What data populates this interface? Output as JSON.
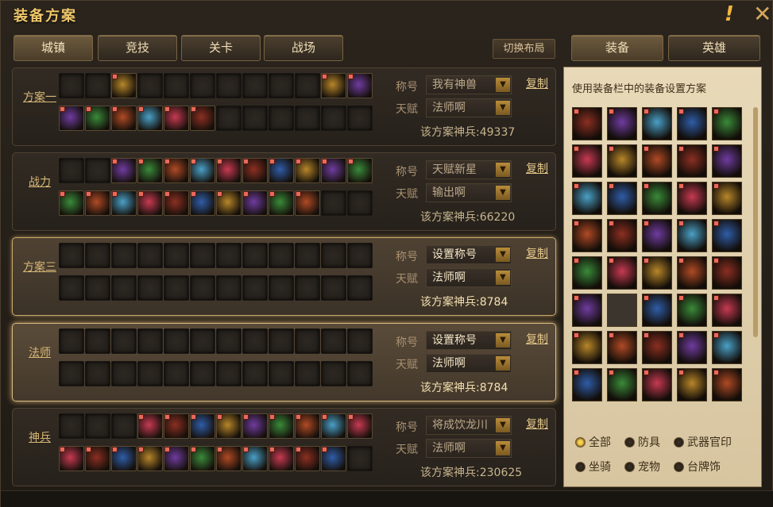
{
  "title": "装备方案",
  "tabs": [
    "城镇",
    "竞技",
    "关卡",
    "战场"
  ],
  "switch_layout": "切换布局",
  "right_tabs": [
    "装备",
    "英雄"
  ],
  "hint": "使用装备栏中的装备设置方案",
  "filters": [
    "全部",
    "防具",
    "武器官印",
    "坐骑",
    "宠物",
    "台牌饰"
  ],
  "labels": {
    "title": "称号",
    "talent": "天赋",
    "copy": "复制"
  },
  "plans": [
    {
      "name": "方案一",
      "title_value": "我有神兽",
      "talent_value": "法师啊",
      "power": "该方案神兵:49337"
    },
    {
      "name": "战力",
      "title_value": "天赋新星",
      "talent_value": "输出啊",
      "power": "该方案神兵:66220"
    },
    {
      "name": "方案三",
      "title_value": "设置称号",
      "talent_value": "法师啊",
      "power": "该方案神兵:8784"
    },
    {
      "name": "法师",
      "title_value": "设置称号",
      "talent_value": "法师啊",
      "power": "该方案神兵:8784"
    },
    {
      "name": "神兵",
      "title_value": "将成饮龙川",
      "talent_value": "法师啊",
      "power": "该方案神兵:230625"
    }
  ],
  "colors": {
    "slot_palettes": [
      "#8c2f22",
      "#2f5da8",
      "#b7862a",
      "#6f3ca0",
      "#3a8a3a",
      "#b04a25",
      "#4aa0c8",
      "#c73a52"
    ]
  }
}
